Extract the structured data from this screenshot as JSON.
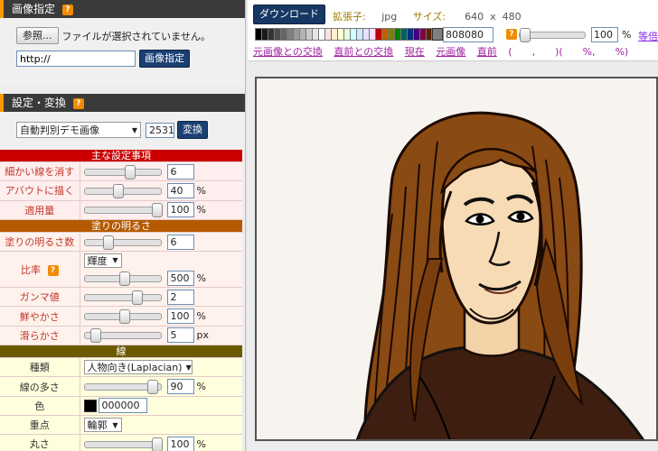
{
  "colors": {
    "accent": "#ff9900",
    "panel_header": "#3a3a3a",
    "brand_button": "#1b3f73",
    "main_red": "#cc0000",
    "paint_brown": "#b55a00",
    "line_olive": "#6b5a00"
  },
  "image_section": {
    "title": "画像指定",
    "help": "?",
    "file_button": "参照...",
    "file_status": "ファイルが選択されていません。",
    "url_value": "http://",
    "submit": "画像指定"
  },
  "settings_section": {
    "title": "設定・変換",
    "help": "?",
    "preset": "自動判別デモ画像",
    "preset_number": "2531",
    "convert": "変換"
  },
  "params": {
    "cat_main": "主な設定事項",
    "fine_lines": {
      "label": "細かい線を消す",
      "value": "6"
    },
    "rough_draw": {
      "label": "アバウトに描く",
      "value": "40",
      "unit": "%"
    },
    "amount": {
      "label": "適用量",
      "value": "100",
      "unit": "%"
    },
    "cat_paint": "塗りの明るさ",
    "paint_count": {
      "label": "塗りの明るさ数",
      "value": "6"
    },
    "ratio": {
      "label": "比率",
      "help": "?",
      "select": "輝度",
      "value": "500",
      "unit": "%"
    },
    "gamma": {
      "label": "ガンマ値",
      "value": "2"
    },
    "vivid": {
      "label": "鮮やかさ",
      "value": "100",
      "unit": "%"
    },
    "smooth": {
      "label": "滑らかさ",
      "value": "5",
      "unit": "px"
    },
    "cat_line": "線",
    "line_type": {
      "label": "種類",
      "select": "人物向き(Laplacian)"
    },
    "line_amount": {
      "label": "線の多さ",
      "value": "90",
      "unit": "%"
    },
    "line_color": {
      "label": "色",
      "value": "000000",
      "swatch": "#000000"
    },
    "emphasis": {
      "label": "重点",
      "select": "輪郭"
    },
    "roundness": {
      "label": "丸さ",
      "value": "100",
      "unit": "%"
    }
  },
  "toolbar": {
    "download": "ダウンロード",
    "ext_label": "拡張子:",
    "ext_value": "jpg",
    "size_label": "サイズ:",
    "size_w": "640",
    "size_x": "x",
    "size_h": "480",
    "bg_hex": "808080",
    "help": "?",
    "zoom": "100",
    "zoom_unit": "%",
    "magnify": "等倍",
    "links": [
      "元画像との交換",
      "直前との交換",
      "現在",
      "元画像",
      "直前"
    ],
    "coords": "(　　,　　)(　　%,　　%)"
  },
  "palette_colors": [
    "#000000",
    "#1a1a1a",
    "#333333",
    "#4d4d4d",
    "#666666",
    "#808080",
    "#999999",
    "#b3b3b3",
    "#cccccc",
    "#e6e6e6",
    "#ffffff",
    "#ffe0e0",
    "#fff0d0",
    "#ffffd0",
    "#e0ffe0",
    "#d0ffff",
    "#d0e8ff",
    "#e8e0ff",
    "#ffe0ff",
    "#c00000",
    "#c06000",
    "#808000",
    "#008000",
    "#006060",
    "#003080",
    "#400080",
    "#800040",
    "#602000",
    "#404000",
    "#004020",
    "#002040",
    "#200040"
  ]
}
